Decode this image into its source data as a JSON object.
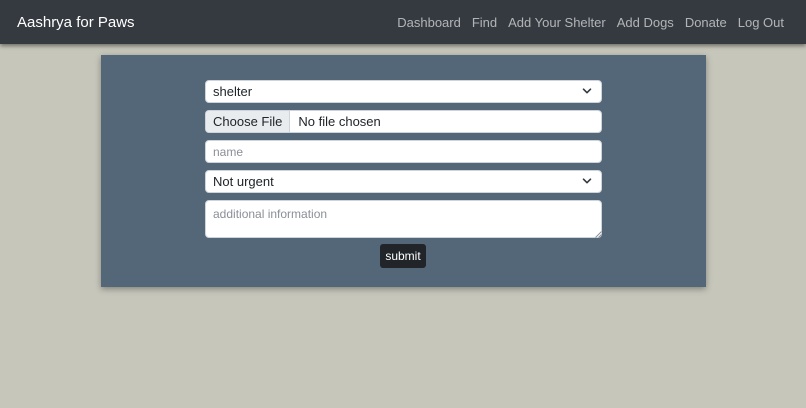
{
  "navbar": {
    "brand": "Aashrya for Paws",
    "links": [
      "Dashboard",
      "Find",
      "Add Your Shelter",
      "Add Dogs",
      "Donate",
      "Log Out"
    ]
  },
  "form": {
    "type_select": {
      "value": "shelter"
    },
    "file_input": {
      "button_label": "Choose File",
      "status": "No file chosen"
    },
    "name_input": {
      "value": "",
      "placeholder": "name"
    },
    "urgency_select": {
      "value": "Not urgent"
    },
    "info_textarea": {
      "value": "",
      "placeholder": "additional information"
    },
    "submit_label": "submit"
  },
  "colors": {
    "page_background": "#c6c6bb",
    "navbar_background": "#343a40",
    "card_background": "#546779",
    "button_background": "#212529"
  },
  "icons": {
    "select_arrow": "chevron-down-icon",
    "textarea_grip": "resize-grip-icon"
  }
}
